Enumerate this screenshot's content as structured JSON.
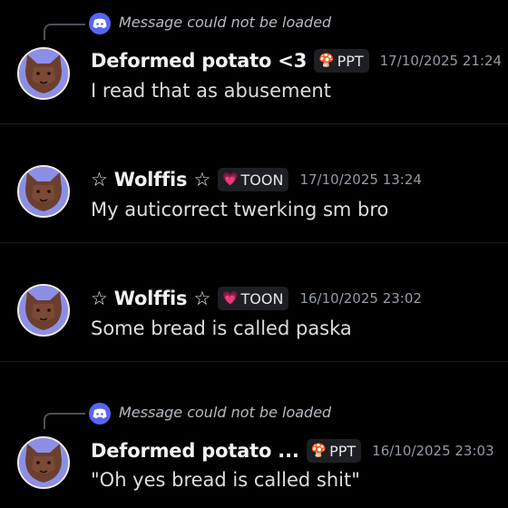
{
  "messages": [
    {
      "reply": "Message could not be loaded",
      "username": "Deformed potato <3",
      "tag_icon": "🍄",
      "tag": "PPT",
      "timestamp": "17/10/2025 21:24",
      "content": "I read that as abusement"
    },
    {
      "username": "☆ Wolffis ☆",
      "tag_icon": "💗",
      "tag": "TOON",
      "timestamp": "17/10/2025 13:24",
      "content": "My auticorrect twerking sm bro"
    },
    {
      "username": "☆ Wolffis ☆",
      "tag_icon": "💗",
      "tag": "TOON",
      "timestamp": "16/10/2025 23:02",
      "content": "Some bread is called paska"
    },
    {
      "reply": "Message could not be loaded",
      "username": "Deformed potato ...",
      "tag_icon": "🍄",
      "tag": "PPT",
      "timestamp": "16/10/2025 23:03",
      "content": "\"Oh yes bread is called shit\""
    }
  ],
  "colors": {
    "background": "#000000",
    "username": "#f2f3f5",
    "content": "#dbdee1",
    "timestamp": "#949ba4",
    "reply_text": "#b5bac1",
    "discord_blurple": "#5865f2",
    "tag_background": "#1e1f22"
  },
  "icons": {
    "reply_icon": "discord-icon",
    "avatar": "avatar-bat-image"
  }
}
